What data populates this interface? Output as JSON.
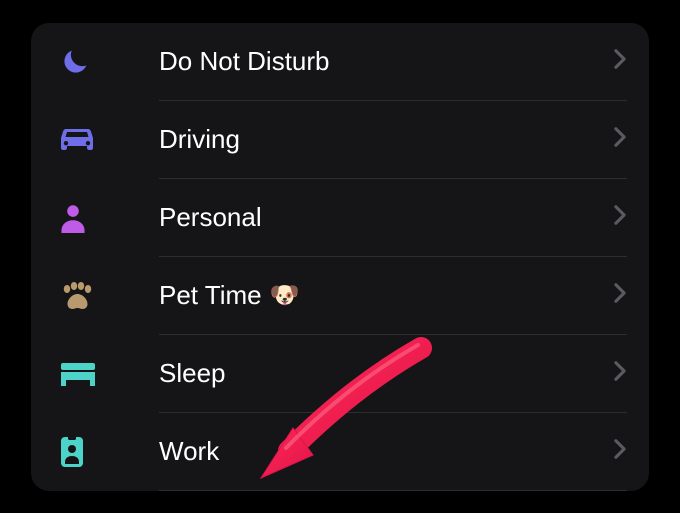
{
  "focus": {
    "items": [
      {
        "label": "Do Not Disturb",
        "iconColor": "#6e6ee8"
      },
      {
        "label": "Driving",
        "iconColor": "#6e6ee8"
      },
      {
        "label": "Personal",
        "iconColor": "#c05be8"
      },
      {
        "label": "Pet Time",
        "emoji": "🐶",
        "iconColor": "#b89a6e"
      },
      {
        "label": "Sleep",
        "iconColor": "#4ed3c9"
      },
      {
        "label": "Work",
        "iconColor": "#4ed3c9"
      }
    ]
  }
}
